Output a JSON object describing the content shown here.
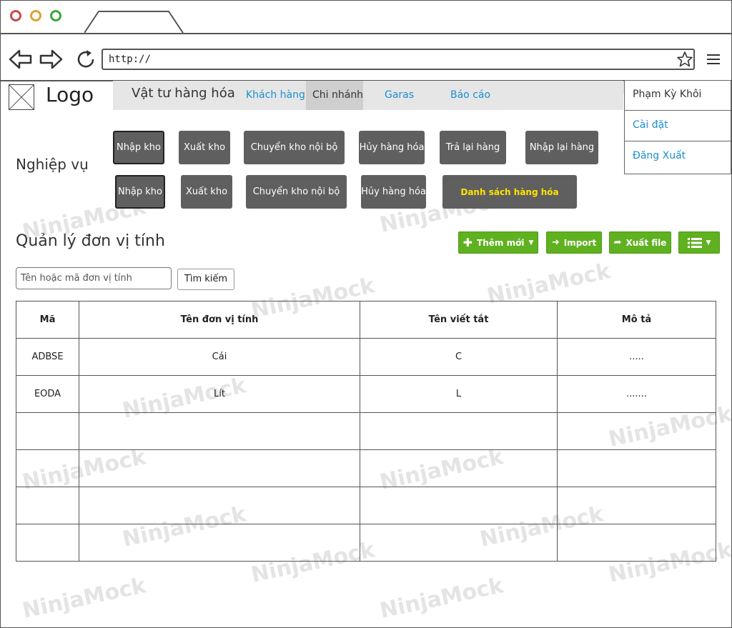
{
  "browser": {
    "url": "http://",
    "icons": [
      "back-arrow-icon",
      "forward-arrow-icon",
      "reload-icon",
      "star-icon",
      "hamburger-menu-icon"
    ]
  },
  "header": {
    "logo": "Logo",
    "nav_main": "Vật tư hàng hóa",
    "nav_links": [
      "Khách hàng",
      "Chi nhánh",
      "Garas",
      "Báo cáo"
    ],
    "active_link": "Chi nhánh"
  },
  "user_menu": {
    "name": "Phạm Kỳ Khôi",
    "items": [
      "Cài đặt",
      "Đăng Xuất"
    ]
  },
  "operations": {
    "label": "Nghiệp vụ",
    "row1": [
      "Nhập kho",
      "Xuất kho",
      "Chuyển kho nội bộ",
      "Hủy hàng hóa",
      "Trả lại hàng",
      "Nhập lại hàng"
    ],
    "row2": [
      "Nhập kho",
      "Xuất kho",
      "Chuyển kho nội bộ",
      "Hủy hàng hóa",
      "Danh sách hàng hóa"
    ]
  },
  "section": {
    "title": "Quản lý đơn vị tính",
    "buttons": {
      "add": "Thêm mới",
      "import": "Import",
      "export": "Xuất file"
    },
    "search": {
      "placeholder": "Tên hoặc mã đơn vị tính",
      "button": "Tìm kiếm"
    }
  },
  "table": {
    "headers": [
      "Mã",
      "Tên đơn vị tính",
      "Tên viết tắt",
      "Mô tả"
    ],
    "rows": [
      [
        "ADBSE",
        "Cái",
        "C",
        "....."
      ],
      [
        "EODA",
        "Lít",
        "L",
        "......."
      ],
      [
        "",
        "",
        "",
        ""
      ],
      [
        "",
        "",
        "",
        ""
      ],
      [
        "",
        "",
        "",
        ""
      ],
      [
        "",
        "",
        "",
        ""
      ]
    ]
  },
  "watermark": "NinjaMock",
  "colors": {
    "green": "#5fb11f",
    "dark_button": "#5f5f5f",
    "link": "#1a8fcf",
    "highlight_text": "#ffe400"
  }
}
